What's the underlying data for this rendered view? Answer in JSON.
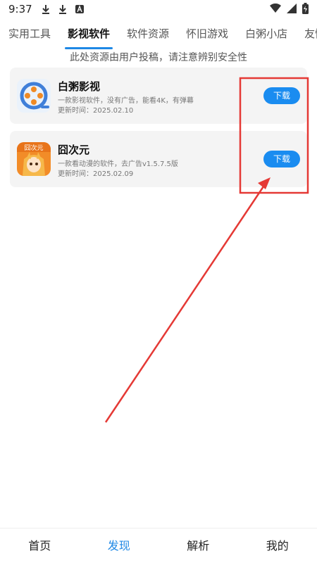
{
  "status_bar": {
    "time": "9:37",
    "left_icons": [
      "download-icon",
      "download-icon",
      "app-icon"
    ],
    "right_icons": [
      "wifi-icon",
      "signal-icon",
      "battery-icon"
    ]
  },
  "tabs": [
    {
      "label": "实用工具"
    },
    {
      "label": "影视软件",
      "active": true
    },
    {
      "label": "软件资源"
    },
    {
      "label": "怀旧游戏"
    },
    {
      "label": "白粥小店"
    },
    {
      "label": "友情链"
    }
  ],
  "notice": "此处资源由用户投稿，请注意辨别安全性",
  "apps": [
    {
      "name": "白粥影视",
      "desc": "一款影视软件，没有广告，能看4K，有弹幕",
      "date": "更新时间：2025.02.10",
      "button": "下载",
      "icon": "film-reel-icon"
    },
    {
      "name": "囧次元",
      "desc": "一款看动漫的软件，去广告v1.5.7.5版",
      "date": "更新时间：2025.02.09",
      "button": "下载",
      "icon": "anime-girl-icon",
      "icon_text": "囧次元"
    }
  ],
  "bottom_nav": [
    {
      "label": "首页"
    },
    {
      "label": "发现",
      "active": true
    },
    {
      "label": "解析"
    },
    {
      "label": "我的"
    }
  ],
  "colors": {
    "accent": "#1e88e5",
    "button": "#1a8cf0",
    "annotation": "#e53935"
  }
}
